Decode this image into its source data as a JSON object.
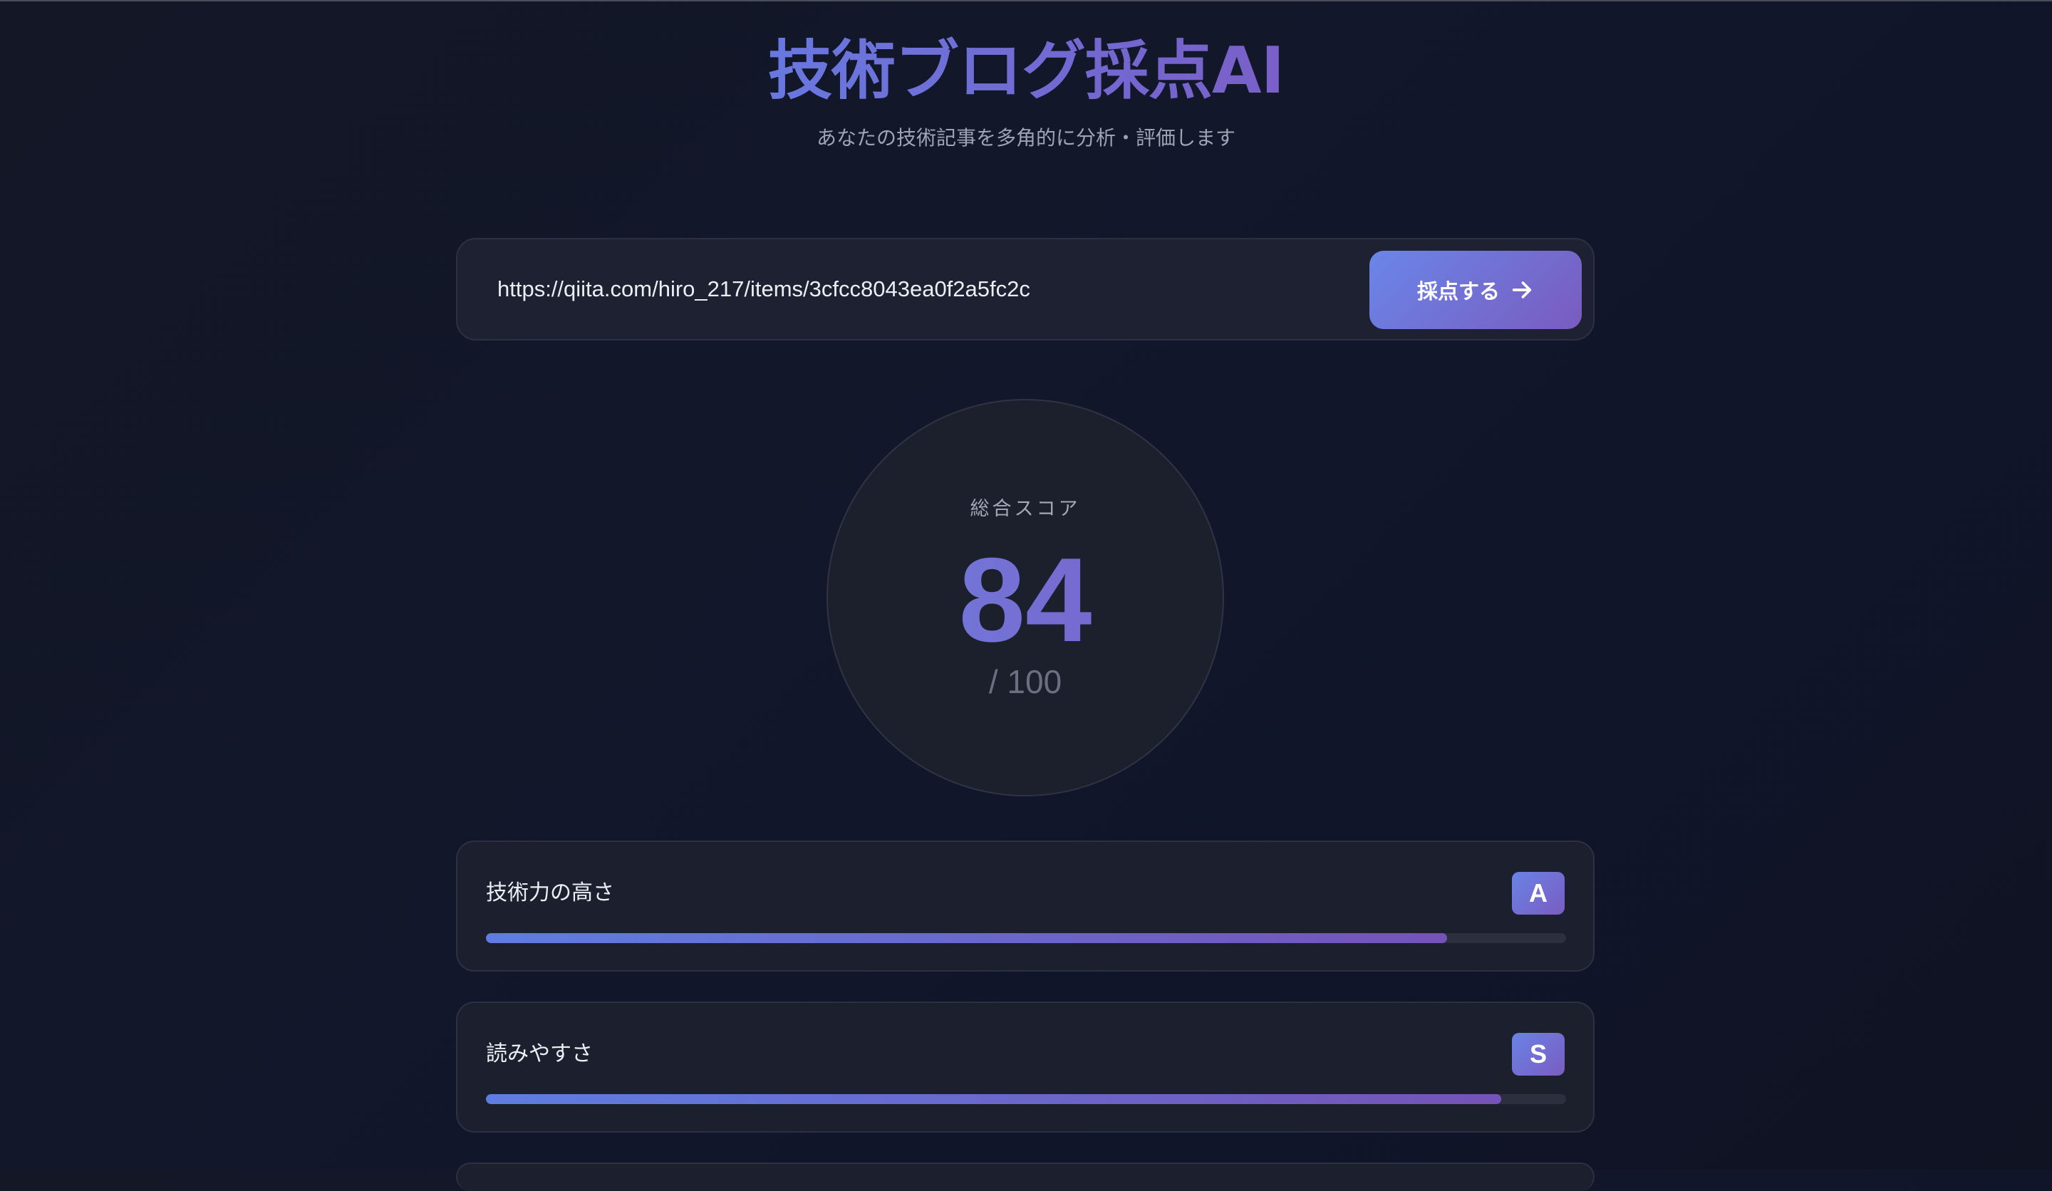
{
  "header": {
    "title": "技術ブログ採点AI",
    "subtitle": "あなたの技術記事を多角的に分析・評価します"
  },
  "url_form": {
    "value": "https://qiita.com/hiro_217/items/3cfcc8043ea0f2a5fc2c",
    "submit_label": "採点する",
    "submit_icon": "arrow-right-icon"
  },
  "score": {
    "label": "総合スコア",
    "value": "84",
    "max_label": "/ 100"
  },
  "metrics": [
    {
      "name": "技術力の高さ",
      "grade": "A",
      "fill_fraction": 0.89
    },
    {
      "name": "読みやすさ",
      "grade": "S",
      "fill_fraction": 0.94
    }
  ],
  "colors": {
    "accent_start": "#6a86e8",
    "accent_end": "#7a5bbf",
    "background": "#12162a"
  }
}
